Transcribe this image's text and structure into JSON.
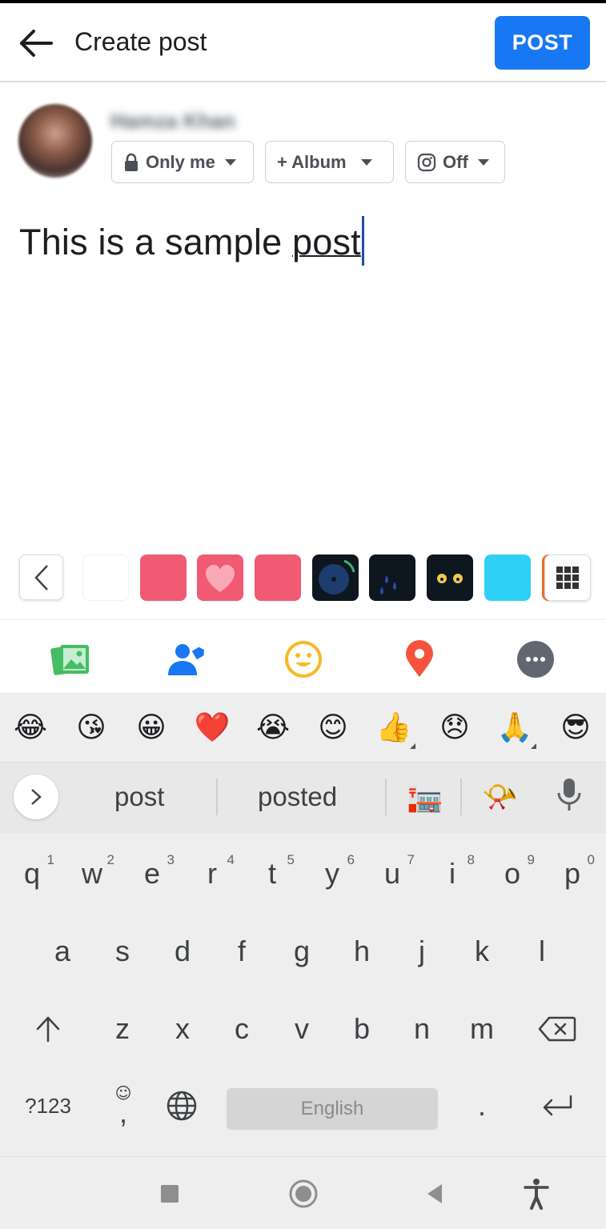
{
  "header": {
    "title": "Create post",
    "post_label": "POST"
  },
  "composer": {
    "username": "Hamza Khan",
    "privacy_label": "Only me",
    "album_label": "+ Album",
    "instagram_label": "Off",
    "text_plain": "This is a sample ",
    "text_underlined": "post"
  },
  "stickers": [
    {
      "name": "blank",
      "color": "#ffffff"
    },
    {
      "name": "pink-square",
      "color": "#f05a72"
    },
    {
      "name": "heart",
      "color": "#f05a72"
    },
    {
      "name": "pink-square-2",
      "color": "#f05a72"
    },
    {
      "name": "vinyl",
      "color": "#0e1620"
    },
    {
      "name": "rain-drops",
      "color": "#0e1620"
    },
    {
      "name": "eyes",
      "color": "#0e1620"
    },
    {
      "name": "cyan",
      "color": "#2fd0f5"
    }
  ],
  "keyboard": {
    "emoji_row": [
      "😂",
      "😘",
      "😀",
      "❤️",
      "😭",
      "😊",
      "👍",
      "😞",
      "🙏",
      "😎"
    ],
    "suggestions": [
      "post",
      "posted"
    ],
    "suggestion_emojis": [
      "🏣",
      "📯"
    ],
    "row1": [
      {
        "letter": "q",
        "num": "1"
      },
      {
        "letter": "w",
        "num": "2"
      },
      {
        "letter": "e",
        "num": "3"
      },
      {
        "letter": "r",
        "num": "4"
      },
      {
        "letter": "t",
        "num": "5"
      },
      {
        "letter": "y",
        "num": "6"
      },
      {
        "letter": "u",
        "num": "7"
      },
      {
        "letter": "i",
        "num": "8"
      },
      {
        "letter": "o",
        "num": "9"
      },
      {
        "letter": "p",
        "num": "0"
      }
    ],
    "row2": [
      "a",
      "s",
      "d",
      "f",
      "g",
      "h",
      "j",
      "k",
      "l"
    ],
    "row3": [
      "z",
      "x",
      "c",
      "v",
      "b",
      "n",
      "m"
    ],
    "symbols_label": "?123",
    "comma_label": ",",
    "period_label": ".",
    "space_label": "English"
  },
  "colors": {
    "accent": "#1877f2",
    "cursor": "#1d4fa5",
    "photo_green": "#45bd62",
    "tag_blue": "#1877f2",
    "feeling_yellow": "#f7b928",
    "checkin_red": "#f5533d",
    "more_gray": "#606770"
  }
}
